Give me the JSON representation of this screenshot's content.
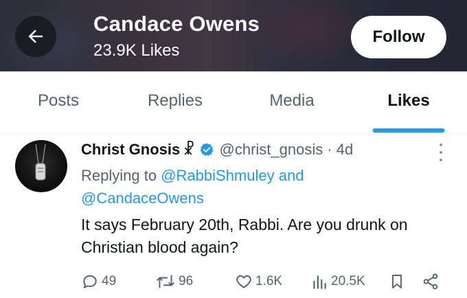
{
  "header": {
    "profile_name": "Candace Owens",
    "likes_count": "23.9K Likes",
    "follow_label": "Follow",
    "back_icon": "arrow-left-icon"
  },
  "tabs": [
    {
      "label": "Posts",
      "active": false
    },
    {
      "label": "Replies",
      "active": false
    },
    {
      "label": "Media",
      "active": false
    },
    {
      "label": "Likes",
      "active": true
    }
  ],
  "post": {
    "author": "Christ Gnosis",
    "author_symbol": "☧",
    "verified": true,
    "handle_time": "@christ_gnosis · 4d",
    "replying_to_prefix": "Replying to",
    "mention_1": "@RabbiShmuley",
    "mention_joiner": "and",
    "mention_2": "@CandaceOwens",
    "text": "It says February 20th, Rabbi. Are you drunk on Christian blood again?",
    "stats": {
      "replies": "49",
      "reposts": "96",
      "likes": "1.6K",
      "views": "20.5K"
    }
  },
  "colors": {
    "accent": "#1d9bf0",
    "secondary_text": "#536471",
    "primary_text": "#0f1419"
  }
}
